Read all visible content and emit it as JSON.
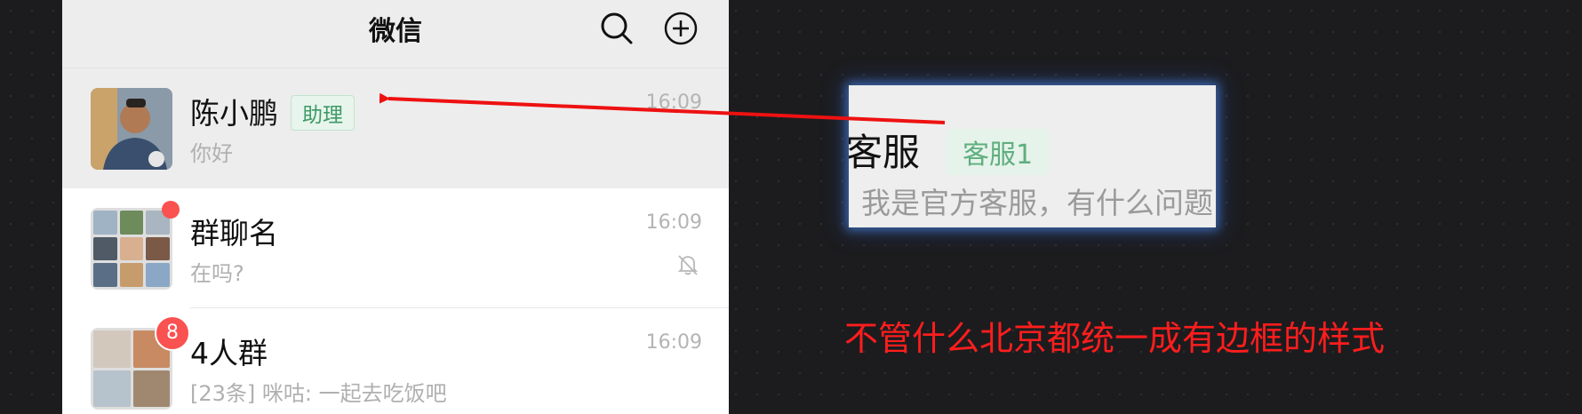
{
  "nav": {
    "title": "微信",
    "icons": [
      "search-icon",
      "add-circle-icon"
    ]
  },
  "chats": [
    {
      "name": "陈小鹏",
      "tag": "助理",
      "preview": "你好",
      "time": "16:09",
      "active": true
    },
    {
      "name": "群聊名",
      "preview": "在吗?",
      "time": "16:09",
      "unread_dot": true,
      "muted": true
    },
    {
      "name": "4人群",
      "preview": "[23条] 咪咕: 一起去吃饭吧",
      "time": "16:09",
      "unread_count": "8"
    }
  ],
  "zoom": {
    "name": "客服",
    "tag": "客服1",
    "preview": "我是官方客服，有什么问题"
  },
  "annotation": "不管什么北京都统一成有边框的样式",
  "colors": {
    "tag_green": "#3e9a65",
    "badge_red": "#fa5151",
    "annotation_red": "#ff1d1d",
    "arrow_red": "#ee1111"
  }
}
